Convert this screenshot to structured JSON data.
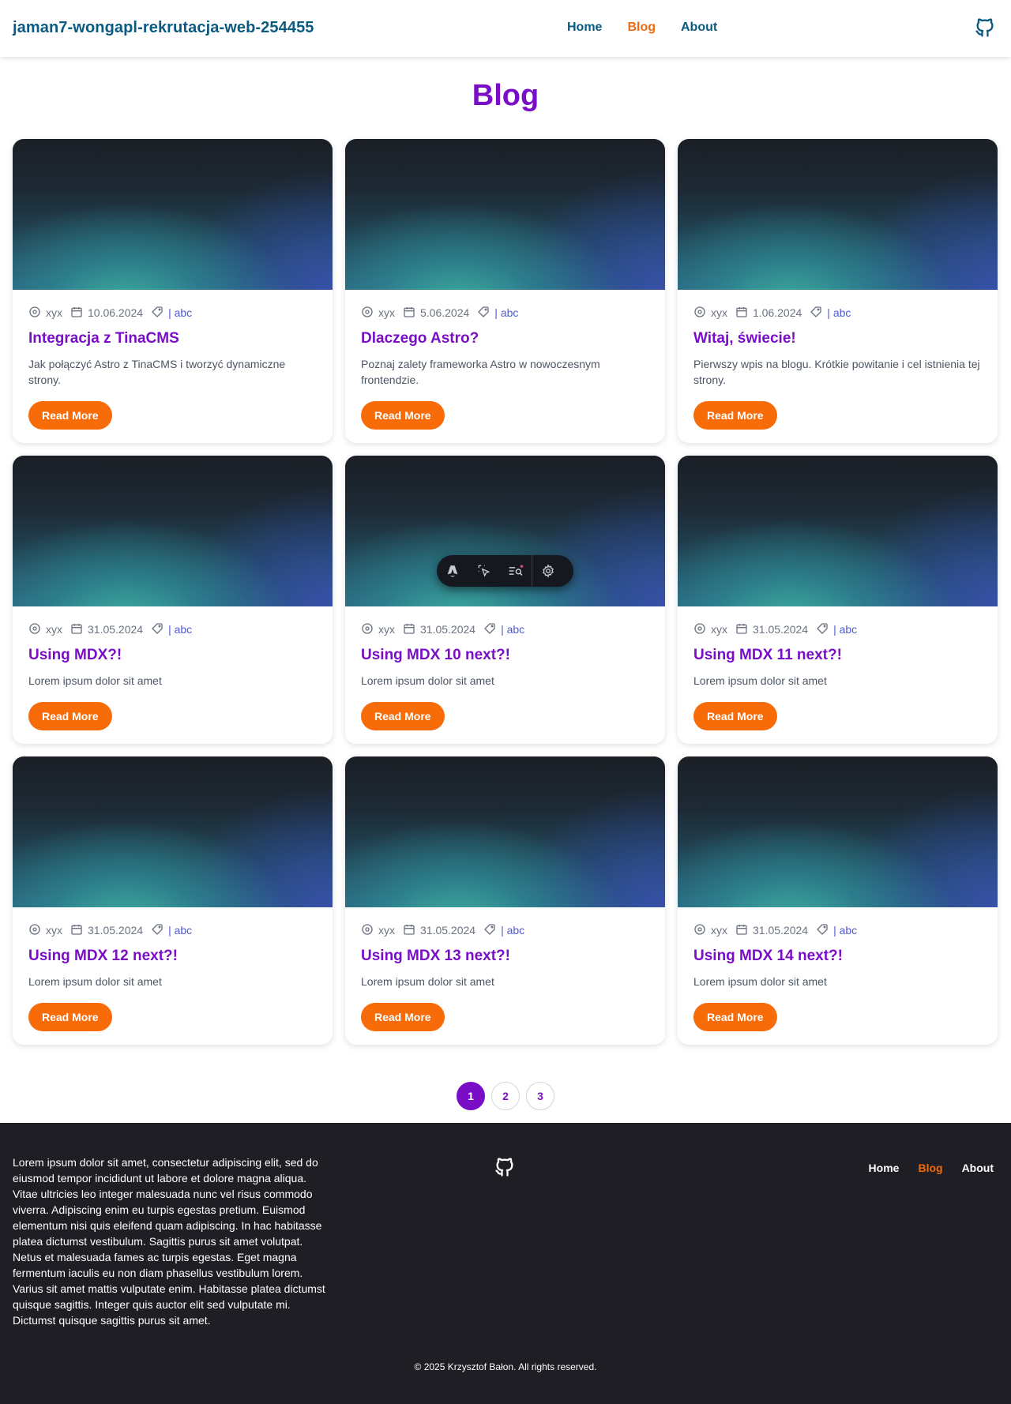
{
  "header": {
    "site_title": "jaman7-wongapl-rekrutacja-web-254455",
    "nav": [
      {
        "label": "Home",
        "active": false
      },
      {
        "label": "Blog",
        "active": true
      },
      {
        "label": "About",
        "active": false
      }
    ],
    "github_icon": "github-icon"
  },
  "page": {
    "title": "Blog"
  },
  "posts": [
    {
      "author": "xyx",
      "date": "10.06.2024",
      "category": "| abc",
      "title": "Integracja z TinaCMS",
      "description": "Jak połączyć Astro z TinaCMS i tworzyć dynamiczne strony.",
      "button": "Read More"
    },
    {
      "author": "xyx",
      "date": "5.06.2024",
      "category": "| abc",
      "title": "Dlaczego Astro?",
      "description": "Poznaj zalety frameworka Astro w nowoczesnym frontendzie.",
      "button": "Read More"
    },
    {
      "author": "xyx",
      "date": "1.06.2024",
      "category": "| abc",
      "title": "Witaj, świecie!",
      "description": "Pierwszy wpis na blogu. Krótkie powitanie i cel istnienia tej strony.",
      "button": "Read More"
    },
    {
      "author": "xyx",
      "date": "31.05.2024",
      "category": "| abc",
      "title": "Using MDX?!",
      "description": "Lorem ipsum dolor sit amet",
      "button": "Read More"
    },
    {
      "author": "xyx",
      "date": "31.05.2024",
      "category": "| abc",
      "title": "Using MDX 10 next?!",
      "description": "Lorem ipsum dolor sit amet",
      "button": "Read More"
    },
    {
      "author": "xyx",
      "date": "31.05.2024",
      "category": "| abc",
      "title": "Using MDX 11 next?!",
      "description": "Lorem ipsum dolor sit amet",
      "button": "Read More"
    },
    {
      "author": "xyx",
      "date": "31.05.2024",
      "category": "| abc",
      "title": "Using MDX 12 next?!",
      "description": "Lorem ipsum dolor sit amet",
      "button": "Read More"
    },
    {
      "author": "xyx",
      "date": "31.05.2024",
      "category": "| abc",
      "title": "Using MDX 13 next?!",
      "description": "Lorem ipsum dolor sit amet",
      "button": "Read More"
    },
    {
      "author": "xyx",
      "date": "31.05.2024",
      "category": "| abc",
      "title": "Using MDX 14 next?!",
      "description": "Lorem ipsum dolor sit amet",
      "button": "Read More"
    }
  ],
  "pagination": {
    "pages": [
      "1",
      "2",
      "3"
    ],
    "current": "1"
  },
  "dev_toolbar": {
    "icons": [
      "astro-logo-icon",
      "inspect-cursor-icon",
      "audit-icon",
      "settings-gear-icon"
    ]
  },
  "footer": {
    "text": "Lorem ipsum dolor sit amet, consectetur adipiscing elit, sed do eiusmod tempor incididunt ut labore et dolore magna aliqua. Vitae ultricies leo integer malesuada nunc vel risus commodo viverra. Adipiscing enim eu turpis egestas pretium. Euismod elementum nisi quis eleifend quam adipiscing. In hac habitasse platea dictumst vestibulum. Sagittis purus sit amet volutpat. Netus et malesuada fames ac turpis egestas. Eget magna fermentum iaculis eu non diam phasellus vestibulum lorem. Varius sit amet mattis vulputate enim. Habitasse platea dictumst quisque sagittis. Integer quis auctor elit sed vulputate mi. Dictumst quisque sagittis purus sit amet.",
    "nav": [
      {
        "label": "Home",
        "active": false
      },
      {
        "label": "Blog",
        "active": true
      },
      {
        "label": "About",
        "active": false
      }
    ],
    "copyright": "© 2025 Krzysztof Bałon. All rights reserved."
  },
  "colors": {
    "title_purple": "#7a0ec7",
    "accent_orange": "#f86b09",
    "nav_blue": "#0b5a80",
    "footer_bg": "#1e1e24"
  }
}
